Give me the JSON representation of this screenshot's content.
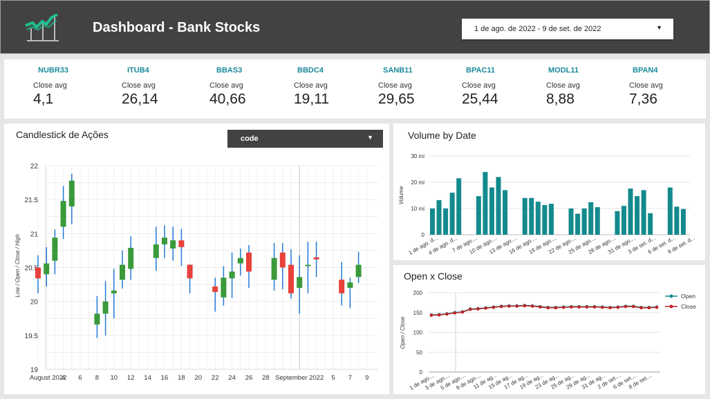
{
  "header": {
    "title": "Dashboard - Bank Stocks",
    "date_range": "1 de ago. de 2022 - 9 de set. de 2022"
  },
  "kpis": [
    {
      "code": "NUBR33",
      "label": "Close  avg",
      "value": "4,1"
    },
    {
      "code": "ITUB4",
      "label": "Close  avg",
      "value": "26,14"
    },
    {
      "code": "BBAS3",
      "label": "Close  avg",
      "value": "40,66"
    },
    {
      "code": "BBDC4",
      "label": "Close  avg",
      "value": "19,11"
    },
    {
      "code": "SANB11",
      "label": "Close  avg",
      "value": "29,65"
    },
    {
      "code": "BPAC11",
      "label": "Close  avg",
      "value": "25,44"
    },
    {
      "code": "MODL11",
      "label": "Close avg",
      "value": "8,88"
    },
    {
      "code": "BPAN4",
      "label": "Close  avg",
      "value": "7,36"
    }
  ],
  "candlestick": {
    "title": "Candlestick de Ações",
    "dropdown_label": "code",
    "ylabel": "Low / Open / Close / High",
    "yticks": [
      "22",
      "21.5",
      "21",
      "20.5",
      "20",
      "19.5",
      "19"
    ],
    "xticks": [
      "August 2022",
      "4",
      "6",
      "8",
      "10",
      "12",
      "14",
      "16",
      "18",
      "20",
      "22",
      "24",
      "26",
      "28",
      "September 2022",
      "5",
      "7",
      "9"
    ],
    "colors": {
      "up": "#3a9a3a",
      "down": "#e8403a",
      "wick": "#1e7ad4"
    }
  },
  "volume": {
    "title": "Volume by Date",
    "ylabel": "Volume",
    "yticks": [
      "30 mi",
      "20 mi",
      "10 mi",
      "0"
    ],
    "xticks": [
      "1 de ago. d...",
      "4 de ago. d...",
      "7 de ago....",
      "10 de ago....",
      "13 de ago....",
      "16 de ago....",
      "19 de ago....",
      "22 de ago....",
      "25 de ago....",
      "28 de ago....",
      "31 de ago....",
      "3 de set. d...",
      "6 de set. d...",
      "9 de set. d..."
    ],
    "bar_color": "#138a8e"
  },
  "openclose": {
    "title": "Open x Close",
    "ylabel": "Open / Close",
    "yticks": [
      "200",
      "150",
      "100",
      "50",
      "0"
    ],
    "xticks": [
      "1 de ago....",
      "3 de ago....",
      "5 de ago....",
      "9 de ago....",
      "11 de ag...",
      "15 de ag...",
      "17 de ag...",
      "19 de ag...",
      "23 de ag...",
      "25 de ag...",
      "29 de ag...",
      "31 de ag...",
      "2 de set....",
      "6 de set....",
      "8 de set...."
    ],
    "legend": [
      "Open",
      "Close"
    ],
    "colors": {
      "open": "#138a8e",
      "close": "#c0222a"
    }
  },
  "chart_data": [
    {
      "type": "candlestick",
      "title": "Candlestick de Ações",
      "ylabel": "Low / Open / Close / High",
      "ylim": [
        19,
        22
      ],
      "x": [
        1,
        2,
        3,
        4,
        5,
        8,
        9,
        10,
        11,
        12,
        15,
        16,
        17,
        18,
        19,
        22,
        23,
        24,
        25,
        26,
        29,
        30,
        31,
        32,
        33,
        34,
        37,
        38,
        39
      ],
      "candles": [
        {
          "open": 20.5,
          "close": 20.34,
          "low": 20.12,
          "high": 20.68
        },
        {
          "open": 20.4,
          "close": 20.56,
          "low": 20.22,
          "high": 20.8
        },
        {
          "open": 20.6,
          "close": 20.94,
          "low": 20.4,
          "high": 21.06
        },
        {
          "open": 21.1,
          "close": 21.48,
          "low": 20.92,
          "high": 21.7
        },
        {
          "open": 21.4,
          "close": 21.78,
          "low": 21.14,
          "high": 21.88
        },
        {
          "open": 19.66,
          "close": 19.82,
          "low": 19.46,
          "high": 20.08
        },
        {
          "open": 19.82,
          "close": 20.0,
          "low": 19.5,
          "high": 20.3
        },
        {
          "open": 20.12,
          "close": 20.16,
          "low": 19.75,
          "high": 20.48
        },
        {
          "open": 20.32,
          "close": 20.54,
          "low": 20.19,
          "high": 20.75
        },
        {
          "open": 20.48,
          "close": 20.79,
          "low": 20.32,
          "high": 20.96
        },
        {
          "open": 20.64,
          "close": 20.84,
          "low": 20.45,
          "high": 21.1
        },
        {
          "open": 20.84,
          "close": 20.94,
          "low": 20.64,
          "high": 21.12
        },
        {
          "open": 20.78,
          "close": 20.9,
          "low": 20.6,
          "high": 21.1
        },
        {
          "open": 20.9,
          "close": 20.8,
          "low": 20.52,
          "high": 21.07
        },
        {
          "open": 20.54,
          "close": 20.34,
          "low": 20.12,
          "high": 20.55
        },
        {
          "open": 20.22,
          "close": 20.14,
          "low": 19.85,
          "high": 20.35
        },
        {
          "open": 20.06,
          "close": 20.35,
          "low": 19.94,
          "high": 20.52
        },
        {
          "open": 20.34,
          "close": 20.44,
          "low": 20.05,
          "high": 20.72
        },
        {
          "open": 20.56,
          "close": 20.64,
          "low": 20.38,
          "high": 20.78
        },
        {
          "open": 20.72,
          "close": 20.44,
          "low": 20.2,
          "high": 20.83
        },
        {
          "open": 20.32,
          "close": 20.64,
          "low": 20.16,
          "high": 20.86
        },
        {
          "open": 20.72,
          "close": 20.5,
          "low": 20.18,
          "high": 20.86
        },
        {
          "open": 20.54,
          "close": 20.12,
          "low": 20.04,
          "high": 20.77
        },
        {
          "open": 20.2,
          "close": 20.36,
          "low": 19.82,
          "high": 20.68
        },
        {
          "open": 20.52,
          "close": 20.54,
          "low": 20.12,
          "high": 20.88
        },
        {
          "open": 20.65,
          "close": 20.62,
          "low": 20.36,
          "high": 20.88
        },
        {
          "open": 20.32,
          "close": 20.12,
          "low": 19.94,
          "high": 20.58
        },
        {
          "open": 20.2,
          "close": 20.28,
          "low": 19.9,
          "high": 20.35
        },
        {
          "open": 20.36,
          "close": 20.54,
          "low": 20.27,
          "high": 20.73
        }
      ]
    },
    {
      "type": "bar",
      "title": "Volume by Date",
      "ylabel": "Volume",
      "ylim": [
        0,
        30000000
      ],
      "x": [
        1,
        2,
        3,
        4,
        5,
        8,
        9,
        10,
        11,
        12,
        15,
        16,
        17,
        18,
        19,
        22,
        23,
        24,
        25,
        26,
        29,
        30,
        31,
        32,
        33,
        34,
        37,
        38,
        39
      ],
      "values": [
        10000000,
        13200000,
        10000000,
        16000000,
        21500000,
        14700000,
        23900000,
        18000000,
        22000000,
        17000000,
        14000000,
        14000000,
        12600000,
        11300000,
        11800000,
        10000000,
        8000000,
        10000000,
        12400000,
        10500000,
        9000000,
        11000000,
        17600000,
        14700000,
        17000000,
        8200000,
        18000000,
        10700000,
        9800000
      ]
    },
    {
      "type": "line",
      "title": "Open x Close",
      "ylabel": "Open / Close",
      "ylim": [
        0,
        200
      ],
      "legend": "top-right",
      "series": [
        {
          "name": "Open",
          "values": [
            144,
            145,
            147,
            150,
            152,
            159,
            160,
            162,
            164,
            166,
            167,
            167,
            168,
            167,
            165,
            163,
            163,
            164,
            165,
            165,
            165,
            165,
            164,
            163,
            164,
            166,
            166,
            163,
            163,
            164
          ]
        },
        {
          "name": "Close",
          "values": [
            143,
            144,
            146,
            149,
            151,
            158,
            159,
            161,
            163,
            165,
            166,
            166,
            167,
            166,
            164,
            162,
            162,
            163,
            164,
            164,
            164,
            164,
            163,
            162,
            163,
            165,
            165,
            162,
            162,
            163
          ]
        }
      ]
    }
  ]
}
